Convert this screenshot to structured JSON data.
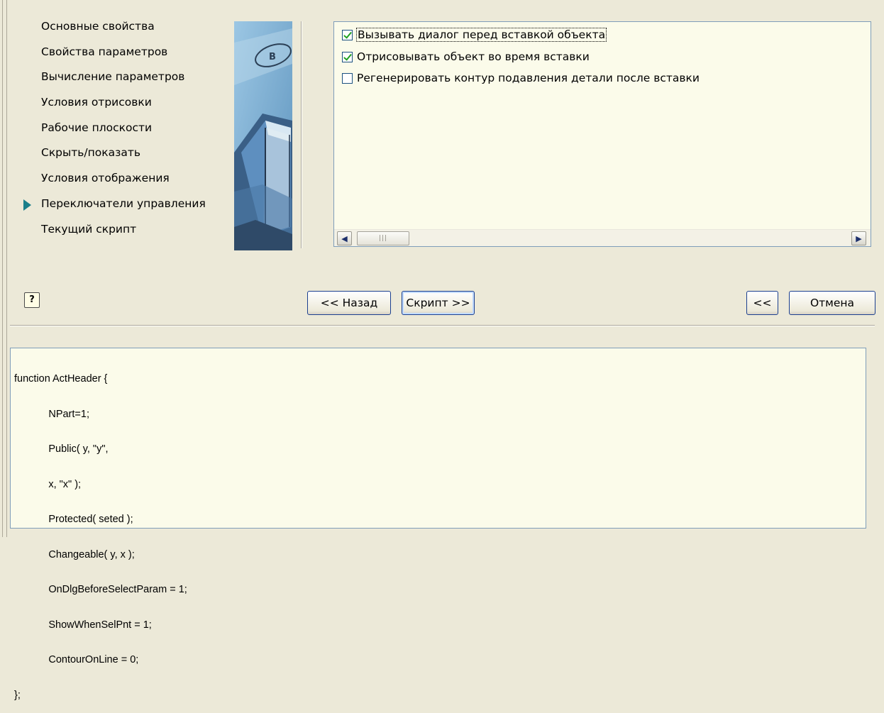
{
  "nav": {
    "items": [
      {
        "label": "Основные свойства",
        "selected": false
      },
      {
        "label": "Свойства параметров",
        "selected": false
      },
      {
        "label": "Вычисление параметров",
        "selected": false
      },
      {
        "label": "Условия отрисовки",
        "selected": false
      },
      {
        "label": "Рабочие плоскости",
        "selected": false
      },
      {
        "label": "Скрыть/показать",
        "selected": false
      },
      {
        "label": "Условия отображения",
        "selected": false
      },
      {
        "label": "Переключатели управления",
        "selected": true
      },
      {
        "label": "Текущий скрипт",
        "selected": false
      }
    ]
  },
  "art": {
    "badge_letter": "B"
  },
  "options": [
    {
      "label": "Вызывать диалог перед вставкой объекта",
      "checked": true
    },
    {
      "label": "Отрисовывать объект во время вставки",
      "checked": true
    },
    {
      "label": "Регенерировать контур подавления детали после вставки",
      "checked": false
    }
  ],
  "scrollbar": {
    "left_arrow": "◀",
    "right_arrow": "▶",
    "thumb_grip": "|||"
  },
  "buttons": {
    "help": "?",
    "back": "<< Назад",
    "script": "Скрипт >>",
    "collapse": "<<",
    "cancel": "Отмена"
  },
  "code": {
    "lines": [
      "function ActHeader {",
      "            NPart=1;",
      "            Public( y, \"y\",",
      "            x, \"x\" );",
      "            Protected( seted );",
      "            Changeable( y, x );",
      "            OnDlgBeforeSelectParam = 1;",
      "            ShowWhenSelPnt = 1;",
      "            ContourOnLine = 0;",
      "};"
    ]
  }
}
